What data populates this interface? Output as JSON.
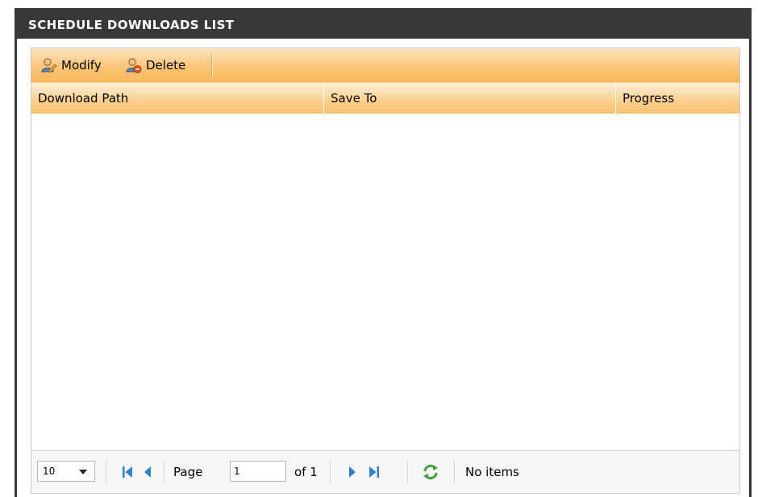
{
  "panel": {
    "title": "SCHEDULE DOWNLOADS LIST"
  },
  "toolbar": {
    "modify_label": "Modify",
    "delete_label": "Delete"
  },
  "columns": {
    "download_path": "Download Path",
    "save_to": "Save To",
    "progress": "Progress"
  },
  "rows": [],
  "pager": {
    "page_size": "10",
    "page_label": "Page",
    "current_page": "1",
    "of_label": "of 1",
    "status": "No items"
  },
  "icons": {
    "modify": "user-edit-icon",
    "delete": "user-delete-icon",
    "first": "first-page-icon",
    "prev": "prev-page-icon",
    "next": "next-page-icon",
    "last": "last-page-icon",
    "refresh": "refresh-icon"
  },
  "colors": {
    "title_bar": "#383838",
    "toolbar_orange": "#fbc578",
    "nav_blue": "#2f7fd6",
    "refresh_green": "#3aa43a"
  }
}
